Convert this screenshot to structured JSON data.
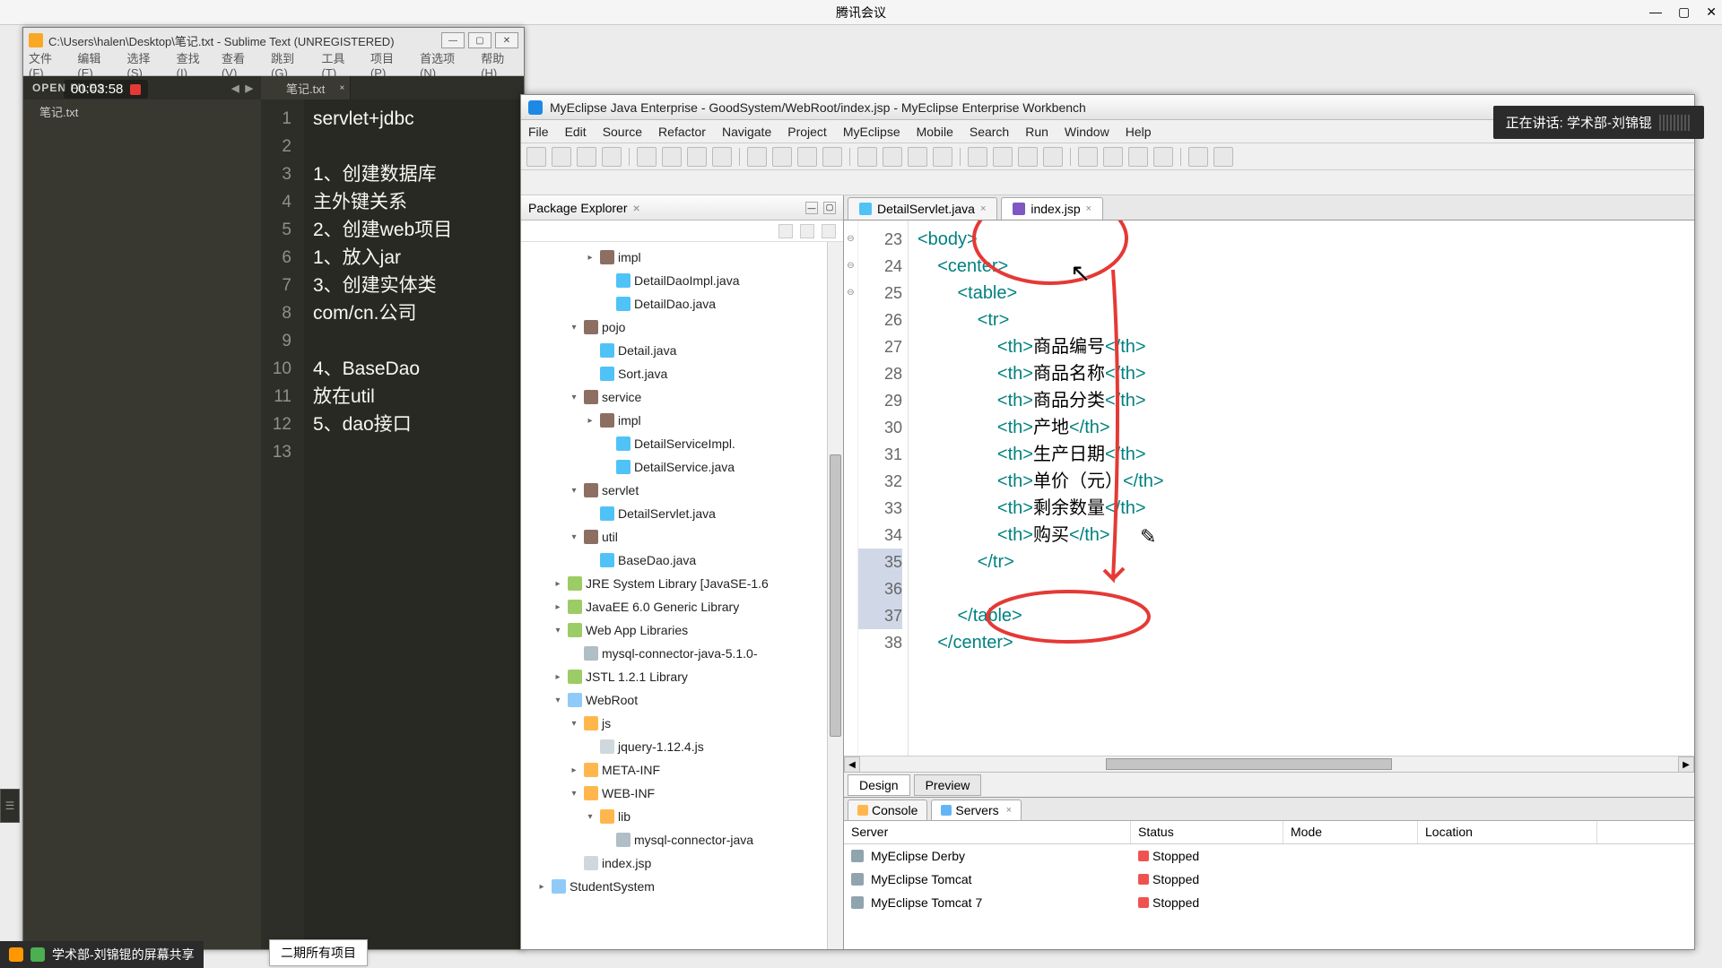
{
  "tencent": {
    "title": "腾讯会议"
  },
  "sublime": {
    "title": "C:\\Users\\halen\\Desktop\\笔记.txt - Sublime Text (UNREGISTERED)",
    "timer": "00:03:58",
    "menu": [
      "文件(F)",
      "编辑(E)",
      "选择(S)",
      "查找(I)",
      "查看(V)",
      "跳到(G)",
      "工具(T)",
      "项目(P)",
      "首选项(N)",
      "帮助(H)"
    ],
    "side_hdr": "OPEN FILES",
    "open_file": "笔记.txt",
    "tab": "笔记.txt",
    "lines": [
      "servlet+jdbc",
      "",
      "1、创建数据库",
      "    主外键关系",
      "2、创建web项目",
      "    1、放入jar",
      "3、创建实体类",
      "    com/cn.公司",
      "",
      "4、BaseDao",
      "    放在util",
      "5、dao接口",
      ""
    ]
  },
  "eclipse": {
    "title": "MyEclipse Java Enterprise - GoodSystem/WebRoot/index.jsp - MyEclipse Enterprise Workbench",
    "menu": [
      "File",
      "Edit",
      "Source",
      "Refactor",
      "Navigate",
      "Project",
      "MyEclipse",
      "Mobile",
      "Search",
      "Run",
      "Window",
      "Help"
    ],
    "pkg_title": "Package Explorer",
    "tree": [
      {
        "ind": 70,
        "tw": "▸",
        "ico": "ico-pkg",
        "label": "impl"
      },
      {
        "ind": 88,
        "tw": "",
        "ico": "ico-j",
        "label": "DetailDaoImpl.java"
      },
      {
        "ind": 88,
        "tw": "",
        "ico": "ico-j",
        "label": "DetailDao.java"
      },
      {
        "ind": 52,
        "tw": "▾",
        "ico": "ico-pkg",
        "label": "pojo"
      },
      {
        "ind": 70,
        "tw": "",
        "ico": "ico-j",
        "label": "Detail.java"
      },
      {
        "ind": 70,
        "tw": "",
        "ico": "ico-j",
        "label": "Sort.java"
      },
      {
        "ind": 52,
        "tw": "▾",
        "ico": "ico-pkg",
        "label": "service"
      },
      {
        "ind": 70,
        "tw": "▸",
        "ico": "ico-pkg",
        "label": "impl"
      },
      {
        "ind": 88,
        "tw": "",
        "ico": "ico-j",
        "label": "DetailServiceImpl."
      },
      {
        "ind": 88,
        "tw": "",
        "ico": "ico-j",
        "label": "DetailService.java"
      },
      {
        "ind": 52,
        "tw": "▾",
        "ico": "ico-pkg",
        "label": "servlet"
      },
      {
        "ind": 70,
        "tw": "",
        "ico": "ico-j",
        "label": "DetailServlet.java"
      },
      {
        "ind": 52,
        "tw": "▾",
        "ico": "ico-pkg",
        "label": "util"
      },
      {
        "ind": 70,
        "tw": "",
        "ico": "ico-j",
        "label": "BaseDao.java"
      },
      {
        "ind": 34,
        "tw": "▸",
        "ico": "ico-lib",
        "label": "JRE System Library [JavaSE-1.6"
      },
      {
        "ind": 34,
        "tw": "▸",
        "ico": "ico-lib",
        "label": "JavaEE 6.0 Generic Library"
      },
      {
        "ind": 34,
        "tw": "▾",
        "ico": "ico-lib",
        "label": "Web App Libraries"
      },
      {
        "ind": 52,
        "tw": "",
        "ico": "ico-jar",
        "label": "mysql-connector-java-5.1.0-"
      },
      {
        "ind": 34,
        "tw": "▸",
        "ico": "ico-lib",
        "label": "JSTL 1.2.1 Library"
      },
      {
        "ind": 34,
        "tw": "▾",
        "ico": "ico-web",
        "label": "WebRoot"
      },
      {
        "ind": 52,
        "tw": "▾",
        "ico": "ico-fld",
        "label": "js"
      },
      {
        "ind": 70,
        "tw": "",
        "ico": "ico-file",
        "label": "jquery-1.12.4.js"
      },
      {
        "ind": 52,
        "tw": "▸",
        "ico": "ico-fld",
        "label": "META-INF"
      },
      {
        "ind": 52,
        "tw": "▾",
        "ico": "ico-fld",
        "label": "WEB-INF"
      },
      {
        "ind": 70,
        "tw": "▾",
        "ico": "ico-fld",
        "label": "lib"
      },
      {
        "ind": 88,
        "tw": "",
        "ico": "ico-jar",
        "label": "mysql-connector-java"
      },
      {
        "ind": 52,
        "tw": "",
        "ico": "ico-file",
        "label": "index.jsp"
      },
      {
        "ind": 16,
        "tw": "▸",
        "ico": "ico-web",
        "label": "StudentSystem"
      }
    ],
    "tabs": [
      {
        "label": "DetailServlet.java",
        "cls": ""
      },
      {
        "label": "index.jsp",
        "cls": "active jsp"
      }
    ],
    "gutter_start": 23,
    "code": [
      {
        "html": "<span class='tag'>&lt;body&gt;</span>"
      },
      {
        "html": "&nbsp;&nbsp;&nbsp;&nbsp;<span class='tag'>&lt;center&gt;</span>"
      },
      {
        "html": "&nbsp;&nbsp;&nbsp;&nbsp;&nbsp;&nbsp;&nbsp;&nbsp;<span class='tag'>&lt;table&gt;</span>"
      },
      {
        "html": "&nbsp;&nbsp;&nbsp;&nbsp;&nbsp;&nbsp;&nbsp;&nbsp;&nbsp;&nbsp;&nbsp;&nbsp;<span class='tag'>&lt;tr&gt;</span>"
      },
      {
        "html": "&nbsp;&nbsp;&nbsp;&nbsp;&nbsp;&nbsp;&nbsp;&nbsp;&nbsp;&nbsp;&nbsp;&nbsp;&nbsp;&nbsp;&nbsp;&nbsp;<span class='tag'>&lt;th&gt;</span>商品编号<span class='tag'>&lt;/th&gt;</span>"
      },
      {
        "html": "&nbsp;&nbsp;&nbsp;&nbsp;&nbsp;&nbsp;&nbsp;&nbsp;&nbsp;&nbsp;&nbsp;&nbsp;&nbsp;&nbsp;&nbsp;&nbsp;<span class='tag'>&lt;th&gt;</span>商品名称<span class='tag'>&lt;/th&gt;</span>"
      },
      {
        "html": "&nbsp;&nbsp;&nbsp;&nbsp;&nbsp;&nbsp;&nbsp;&nbsp;&nbsp;&nbsp;&nbsp;&nbsp;&nbsp;&nbsp;&nbsp;&nbsp;<span class='tag'>&lt;th&gt;</span>商品分类<span class='tag'>&lt;/th&gt;</span>"
      },
      {
        "html": "&nbsp;&nbsp;&nbsp;&nbsp;&nbsp;&nbsp;&nbsp;&nbsp;&nbsp;&nbsp;&nbsp;&nbsp;&nbsp;&nbsp;&nbsp;&nbsp;<span class='tag'>&lt;th&gt;</span>产地<span class='tag'>&lt;/th&gt;</span>"
      },
      {
        "html": "&nbsp;&nbsp;&nbsp;&nbsp;&nbsp;&nbsp;&nbsp;&nbsp;&nbsp;&nbsp;&nbsp;&nbsp;&nbsp;&nbsp;&nbsp;&nbsp;<span class='tag'>&lt;th&gt;</span>生产日期<span class='tag'>&lt;/th&gt;</span>"
      },
      {
        "html": "&nbsp;&nbsp;&nbsp;&nbsp;&nbsp;&nbsp;&nbsp;&nbsp;&nbsp;&nbsp;&nbsp;&nbsp;&nbsp;&nbsp;&nbsp;&nbsp;<span class='tag'>&lt;th&gt;</span>单价（元）<span class='tag'>&lt;/th&gt;</span>"
      },
      {
        "html": "&nbsp;&nbsp;&nbsp;&nbsp;&nbsp;&nbsp;&nbsp;&nbsp;&nbsp;&nbsp;&nbsp;&nbsp;&nbsp;&nbsp;&nbsp;&nbsp;<span class='tag'>&lt;th&gt;</span>剩余数量<span class='tag'>&lt;/th&gt;</span>"
      },
      {
        "html": "&nbsp;&nbsp;&nbsp;&nbsp;&nbsp;&nbsp;&nbsp;&nbsp;&nbsp;&nbsp;&nbsp;&nbsp;&nbsp;&nbsp;&nbsp;&nbsp;<span class='tag'>&lt;th&gt;</span>购买<span class='tag'>&lt;/th&gt;</span>"
      },
      {
        "html": "&nbsp;&nbsp;&nbsp;&nbsp;&nbsp;&nbsp;&nbsp;&nbsp;&nbsp;&nbsp;&nbsp;&nbsp;<span class='tag'>&lt;/tr&gt;</span>"
      },
      {
        "html": "&nbsp;"
      },
      {
        "html": "&nbsp;&nbsp;&nbsp;&nbsp;&nbsp;&nbsp;&nbsp;&nbsp;<span class='tag'>&lt;/table&gt;</span>"
      },
      {
        "html": "&nbsp;&nbsp;&nbsp;&nbsp;<span class='tag'>&lt;/center&gt;</span>"
      }
    ],
    "bottom_tabs": [
      "Design",
      "Preview"
    ],
    "servers_tabs": [
      {
        "label": "Console",
        "ico": "c",
        "active": false,
        "close": false
      },
      {
        "label": "Servers",
        "ico": "s",
        "active": true,
        "close": true
      }
    ],
    "servers_cols": [
      "Server",
      "Status",
      "Mode",
      "Location"
    ],
    "servers_rows": [
      {
        "name": "MyEclipse Derby",
        "status": "Stopped"
      },
      {
        "name": "MyEclipse Tomcat",
        "status": "Stopped"
      },
      {
        "name": "MyEclipse Tomcat 7",
        "status": "Stopped"
      }
    ]
  },
  "tip": "正在讲话: 学术部-刘锦锟",
  "share": "学术部-刘锦锟的屏幕共享",
  "task_hint": "二期所有项目"
}
